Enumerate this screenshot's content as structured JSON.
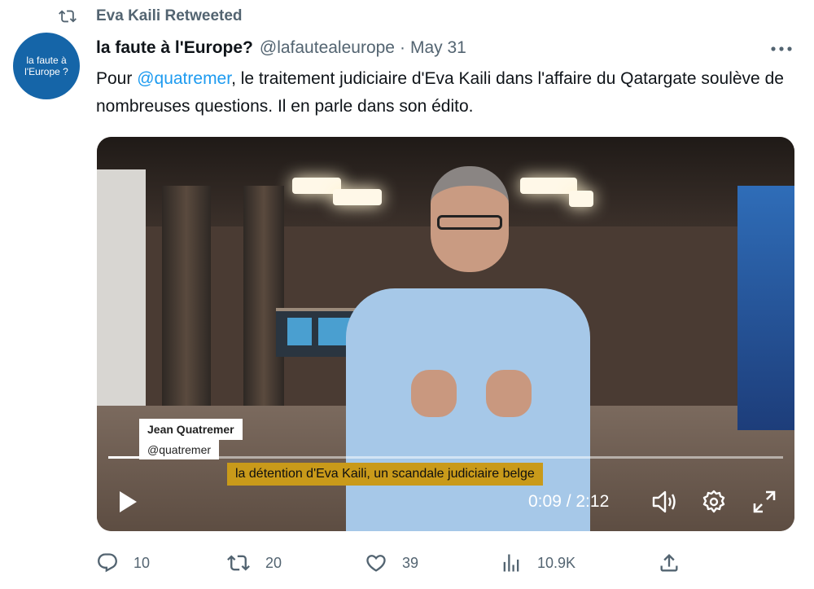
{
  "retweet": {
    "label": "Eva Kaili Retweeted",
    "icon": "retweet-icon"
  },
  "avatar": {
    "line1": "la faute à",
    "line2": "l'Europe ?"
  },
  "author": {
    "name": "la faute à l'Europe?",
    "handle": "@lafautealeurope",
    "separator": "·",
    "date": "May 31"
  },
  "more_icon": "more-icon",
  "tweet": {
    "before_mention": "Pour ",
    "mention": "@quatremer",
    "after_mention": ", le traitement judiciaire d'Eva Kaili dans l'affaire du Qatargate soulève de nombreuses questions. Il en parle dans son édito."
  },
  "video": {
    "lower_third_name": "Jean Quatremer",
    "lower_third_handle": "@quatremer",
    "caption": "la détention d'Eva Kaili, un scandale judiciaire belge",
    "time": "0:09 / 2:12",
    "progress_fraction": 0.071,
    "icons": [
      "play-icon",
      "volume-icon",
      "settings-icon",
      "fullscreen-icon"
    ]
  },
  "actions": {
    "replies": "10",
    "retweets": "20",
    "likes": "39",
    "views": "10.9K"
  },
  "colors": {
    "link": "#1d9bf0",
    "muted": "#536471",
    "caption_bg": "#c99a1a"
  }
}
